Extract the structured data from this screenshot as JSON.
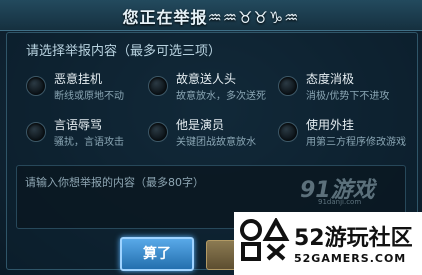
{
  "dialog": {
    "title": "您正在举报♒♒♉♉♑♒",
    "subtitle": "请选择举报内容（最多可选三项）",
    "options": [
      {
        "label": "恶意挂机",
        "desc": "断线或原地不动"
      },
      {
        "label": "故意送人头",
        "desc": "故意放水，多次送死"
      },
      {
        "label": "态度消极",
        "desc": "消极/优势下不进攻"
      },
      {
        "label": "言语辱骂",
        "desc": "骚扰，言语攻击"
      },
      {
        "label": "他是演员",
        "desc": "关键团战故意放水"
      },
      {
        "label": "使用外挂",
        "desc": "用第三方程序修改游戏"
      }
    ],
    "textarea_placeholder": "请输入你想举报的内容（最多80字）",
    "confirm_label": "算了"
  },
  "watermark": {
    "text": "91游戏",
    "sub": "91danji.com"
  },
  "brand": {
    "name": "52游玩社区",
    "url": "52GAMERS.COM"
  }
}
